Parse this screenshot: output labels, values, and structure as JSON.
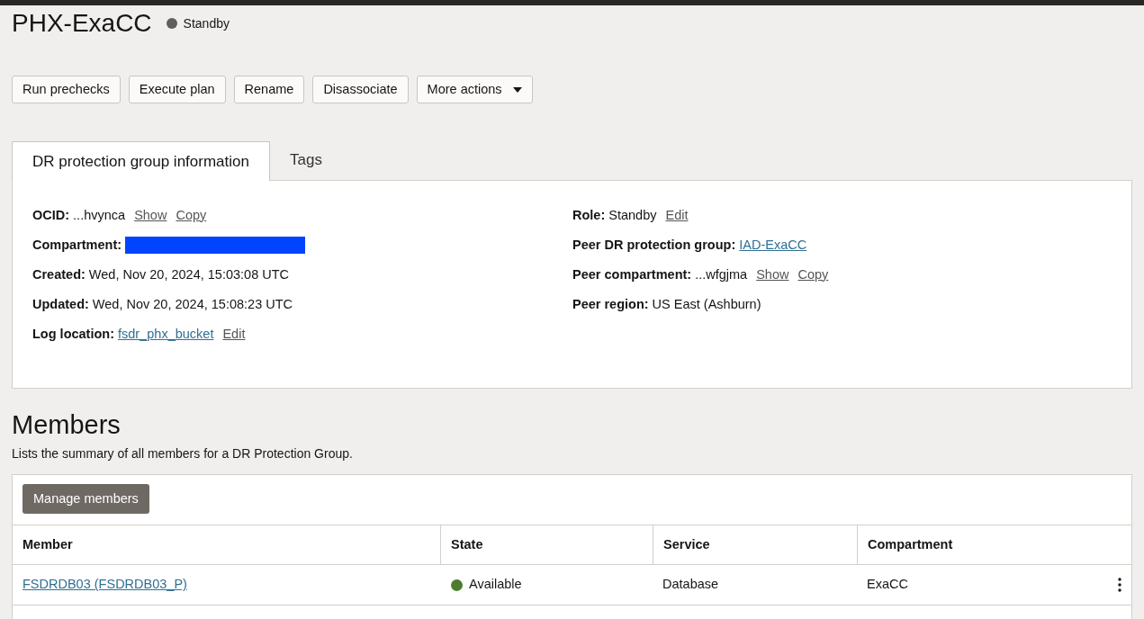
{
  "title": "PHX-ExaCC",
  "status": {
    "text": "Standby",
    "color": "#5f5f5f"
  },
  "actions": [
    {
      "label": "Run prechecks",
      "dropdown": false
    },
    {
      "label": "Execute plan",
      "dropdown": false
    },
    {
      "label": "Rename",
      "dropdown": false
    },
    {
      "label": "Disassociate",
      "dropdown": false
    },
    {
      "label": "More actions",
      "dropdown": true
    }
  ],
  "tabs": [
    {
      "label": "DR protection group information",
      "selected": true
    },
    {
      "label": "Tags",
      "selected": false
    }
  ],
  "info_left": [
    {
      "label": "OCID:",
      "parts": [
        {
          "kind": "text",
          "text": "...hvynca"
        },
        {
          "kind": "action",
          "text": "Show"
        },
        {
          "kind": "action",
          "text": "Copy"
        }
      ]
    },
    {
      "label": "Compartment:",
      "parts": [
        {
          "kind": "redacted"
        }
      ]
    },
    {
      "label": "Created:",
      "parts": [
        {
          "kind": "text",
          "text": "Wed, Nov 20, 2024, 15:03:08 UTC"
        }
      ]
    },
    {
      "label": "Updated:",
      "parts": [
        {
          "kind": "text",
          "text": "Wed, Nov 20, 2024, 15:08:23 UTC"
        }
      ]
    },
    {
      "label": "Log location:",
      "parts": [
        {
          "kind": "link",
          "text": "fsdr_phx_bucket"
        },
        {
          "kind": "action",
          "text": "Edit"
        }
      ]
    }
  ],
  "info_right": [
    {
      "label": "Role:",
      "parts": [
        {
          "kind": "text",
          "text": "Standby"
        },
        {
          "kind": "action",
          "text": "Edit"
        }
      ]
    },
    {
      "label": "Peer DR protection group:",
      "parts": [
        {
          "kind": "link",
          "text": "IAD-ExaCC"
        }
      ]
    },
    {
      "label": "Peer compartment:",
      "parts": [
        {
          "kind": "text",
          "text": "...wfgjma"
        },
        {
          "kind": "action",
          "text": "Show"
        },
        {
          "kind": "action",
          "text": "Copy"
        }
      ]
    },
    {
      "label": "Peer region:",
      "parts": [
        {
          "kind": "text",
          "text": "US East (Ashburn)"
        }
      ]
    }
  ],
  "members": {
    "heading": "Members",
    "description": "Lists the summary of all members for a DR Protection Group.",
    "button": "Manage members",
    "columns": [
      "Member",
      "State",
      "Service",
      "Compartment"
    ],
    "rows": [
      {
        "member": "FSDRDB03 (FSDRDB03_P)",
        "state": "Available",
        "color": "#4e7d2f",
        "service": "Database",
        "compartment": "ExaCC"
      }
    ]
  }
}
